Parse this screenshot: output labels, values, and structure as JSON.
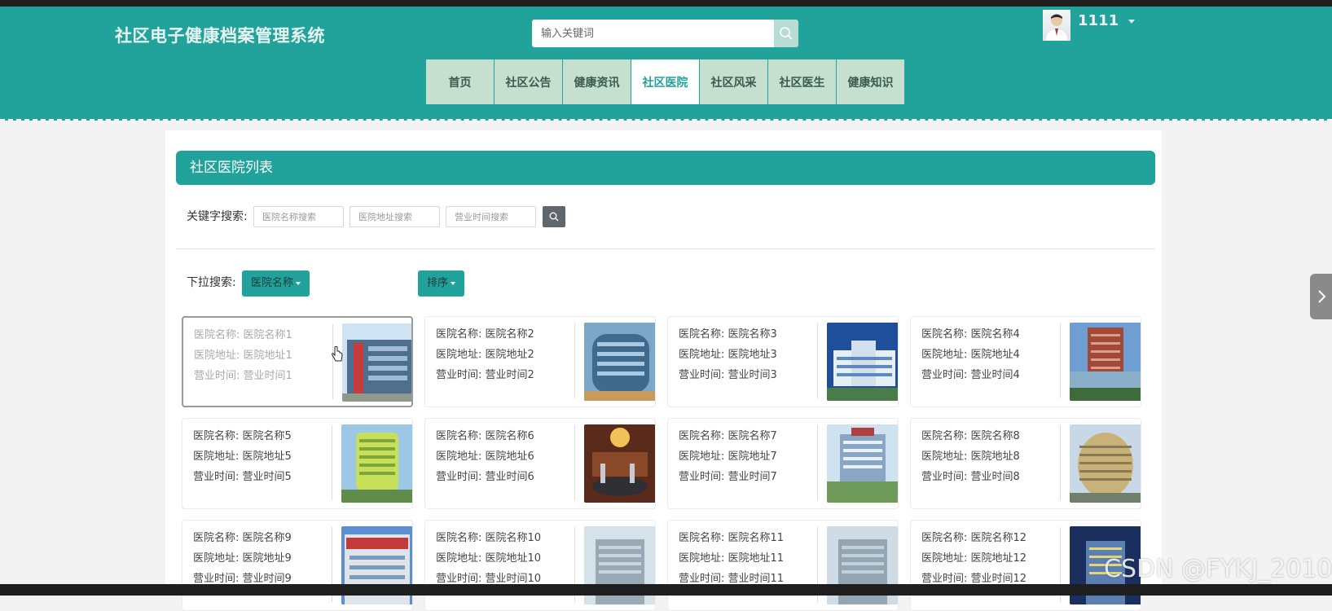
{
  "header": {
    "site_title": "社区电子健康档案管理系统",
    "search_placeholder": "输入关键词",
    "username": "1111"
  },
  "nav": [
    "首页",
    "社区公告",
    "健康资讯",
    "社区医院",
    "社区风采",
    "社区医生",
    "健康知识"
  ],
  "nav_active": "社区医院",
  "panel": {
    "title": "社区医院列表",
    "keyword_label": "关键字搜索:",
    "name_placeholder": "医院名称搜索",
    "address_placeholder": "医院地址搜索",
    "hours_placeholder": "营业时间搜索",
    "dropdown_label": "下拉搜索:",
    "dropdown_button": "医院名称",
    "sort_button": "排序"
  },
  "hospitals": [
    {
      "name": "医院名称: 医院名称1",
      "address": "医院地址: 医院地址1",
      "hours": "营业时间: 营业时间1"
    },
    {
      "name": "医院名称: 医院名称2",
      "address": "医院地址: 医院地址2",
      "hours": "营业时间: 营业时间2"
    },
    {
      "name": "医院名称: 医院名称3",
      "address": "医院地址: 医院地址3",
      "hours": "营业时间: 营业时间3"
    },
    {
      "name": "医院名称: 医院名称4",
      "address": "医院地址: 医院地址4",
      "hours": "营业时间: 营业时间4"
    },
    {
      "name": "医院名称: 医院名称5",
      "address": "医院地址: 医院地址5",
      "hours": "营业时间: 营业时间5"
    },
    {
      "name": "医院名称: 医院名称6",
      "address": "医院地址: 医院地址6",
      "hours": "营业时间: 营业时间6"
    },
    {
      "name": "医院名称: 医院名称7",
      "address": "医院地址: 医院地址7",
      "hours": "营业时间: 营业时间7"
    },
    {
      "name": "医院名称: 医院名称8",
      "address": "医院地址: 医院地址8",
      "hours": "营业时间: 营业时间8"
    },
    {
      "name": "医院名称: 医院名称9",
      "address": "医院地址: 医院地址9",
      "hours": "营业时间: 营业时间9"
    },
    {
      "name": "医院名称: 医院名称10",
      "address": "医院地址: 医院地址10",
      "hours": "营业时间: 营业时间10"
    },
    {
      "name": "医院名称: 医院名称11",
      "address": "医院地址: 医院地址11",
      "hours": "营业时间: 营业时间11"
    },
    {
      "name": "医院名称: 医院名称12",
      "address": "医院地址: 医院地址12",
      "hours": "营业时间: 营业时间12"
    }
  ],
  "watermark": "CSDN @FYKJ_2010",
  "colors": {
    "primary": "#21a39c",
    "nav_bg": "#c5e0cf",
    "search_button": "#b6dcd3",
    "keyword_button": "#60666d"
  },
  "icons": {
    "search": "search-icon",
    "user_menu": "chevron-down-icon",
    "side_panel": "chevron-right-icon"
  }
}
